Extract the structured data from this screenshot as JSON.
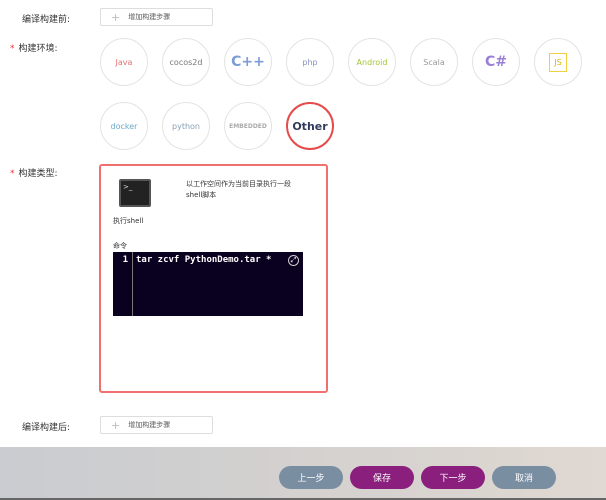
{
  "form": {
    "pre_build_label": "编译构建前:",
    "env_label": "构建环境:",
    "type_label": "构建类型:",
    "post_build_label": "编译构建后:",
    "add_step": "增加构建步骤"
  },
  "environments": [
    {
      "name": "java",
      "label": "Java"
    },
    {
      "name": "cocos",
      "label": "cocos2d"
    },
    {
      "name": "cpp",
      "label": "C++"
    },
    {
      "name": "php",
      "label": "php"
    },
    {
      "name": "android",
      "label": "Android"
    },
    {
      "name": "scala",
      "label": "Scala"
    },
    {
      "name": "csharp",
      "label": "C#"
    },
    {
      "name": "js",
      "label": "JS"
    },
    {
      "name": "docker",
      "label": "docker"
    },
    {
      "name": "python",
      "label": "python"
    },
    {
      "name": "embedded",
      "label": "EMBEDDED"
    },
    {
      "name": "other",
      "label": "Other",
      "selected": true
    }
  ],
  "build_type": {
    "name": "执行shell",
    "description": "以工作空间作为当前目录执行一段shell脚本",
    "command_label": "命令",
    "line_number": "1",
    "command": "tar zcvf PythonDemo.tar *"
  },
  "footer": {
    "prev": "上一步",
    "save": "保存",
    "next": "下一步",
    "cancel": "取消"
  },
  "colors": {
    "accent": "#8a1f7d",
    "secondary": "#7a8ea2",
    "selected": "#e64a4a"
  }
}
